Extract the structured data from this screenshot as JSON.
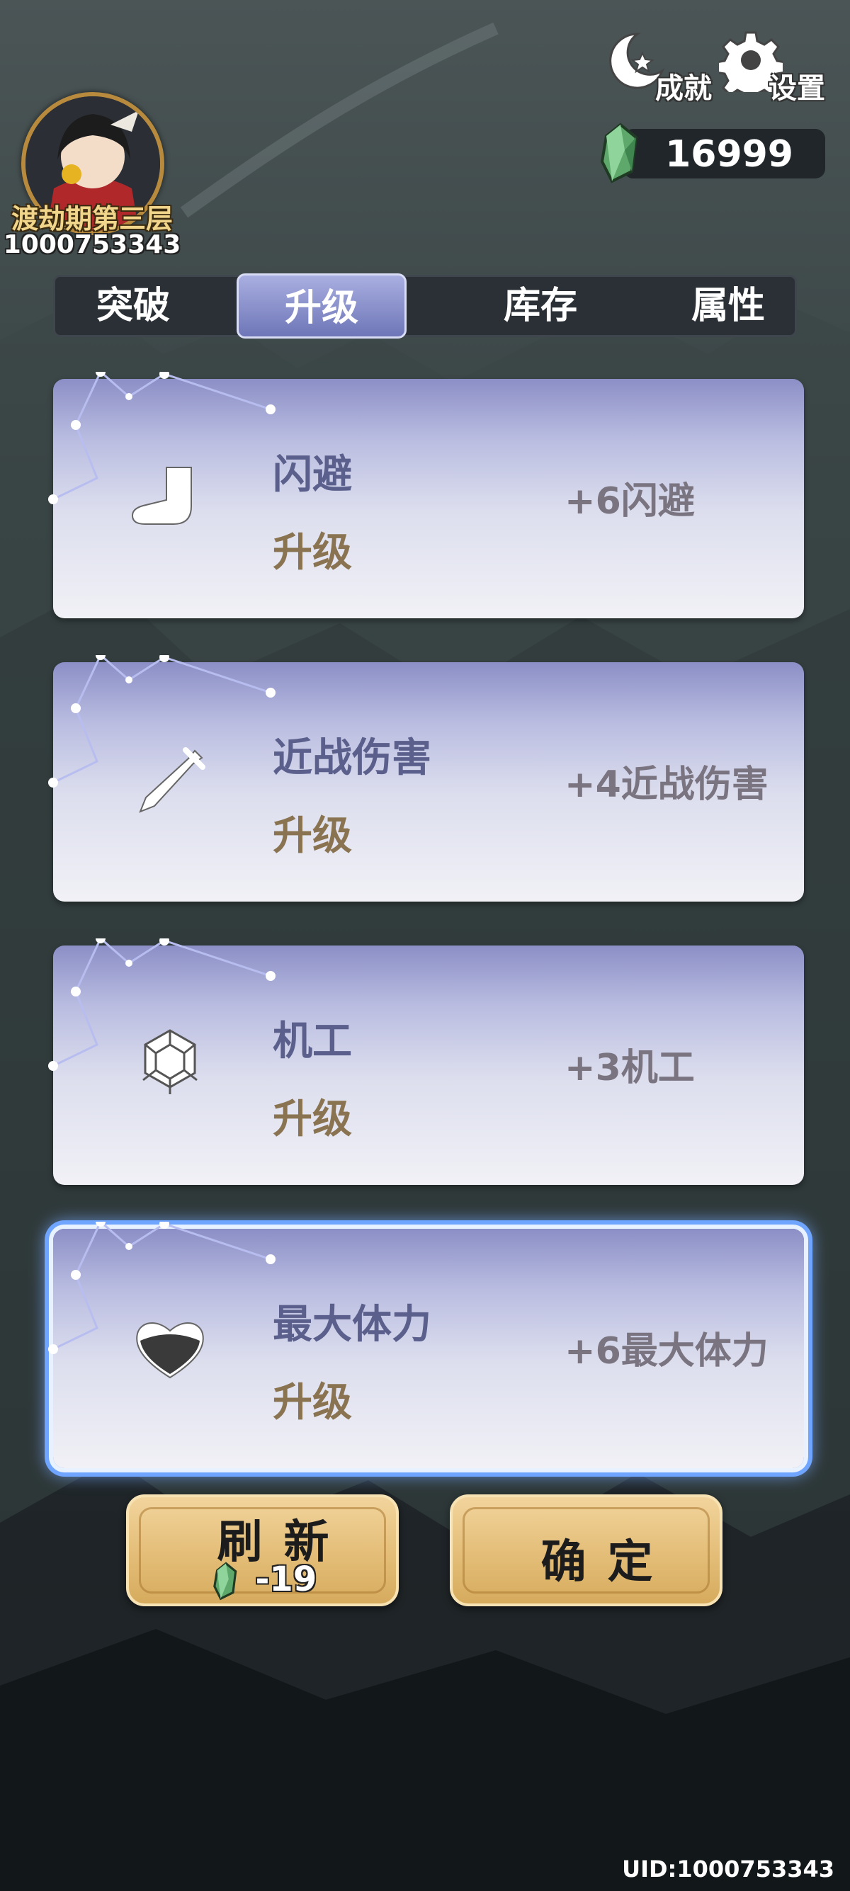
{
  "header": {
    "rank": "渡劫期第三层",
    "player_id": "1000753343",
    "achievements_label": "成就",
    "settings_label": "设置",
    "currency_value": "16999"
  },
  "tabs": [
    {
      "label": "突破",
      "active": false
    },
    {
      "label": "升级",
      "active": true
    },
    {
      "label": "库存",
      "active": false
    },
    {
      "label": "属性",
      "active": false
    }
  ],
  "cards": [
    {
      "name": "闪避",
      "action": "升级",
      "effect": "+6闪避",
      "icon": "boot-icon",
      "selected": false
    },
    {
      "name": "近战伤害",
      "action": "升级",
      "effect": "+4近战伤害",
      "icon": "sword-icon",
      "selected": false
    },
    {
      "name": "机工",
      "action": "升级",
      "effect": "+3机工",
      "icon": "gear-cube-icon",
      "selected": false
    },
    {
      "name": "最大体力",
      "action": "升级",
      "effect": "+6最大体力",
      "icon": "heart-icon",
      "selected": true
    }
  ],
  "buttons": {
    "refresh_label": "刷新",
    "refresh_cost": "-19",
    "confirm_label": "确定"
  },
  "footer": {
    "uid": "UID:1000753343"
  },
  "colors": {
    "card_title": "#5b5f8c",
    "card_action": "#8a7350",
    "selected_glow": "#6fa4ff",
    "gold_button": "#e2bb74"
  }
}
